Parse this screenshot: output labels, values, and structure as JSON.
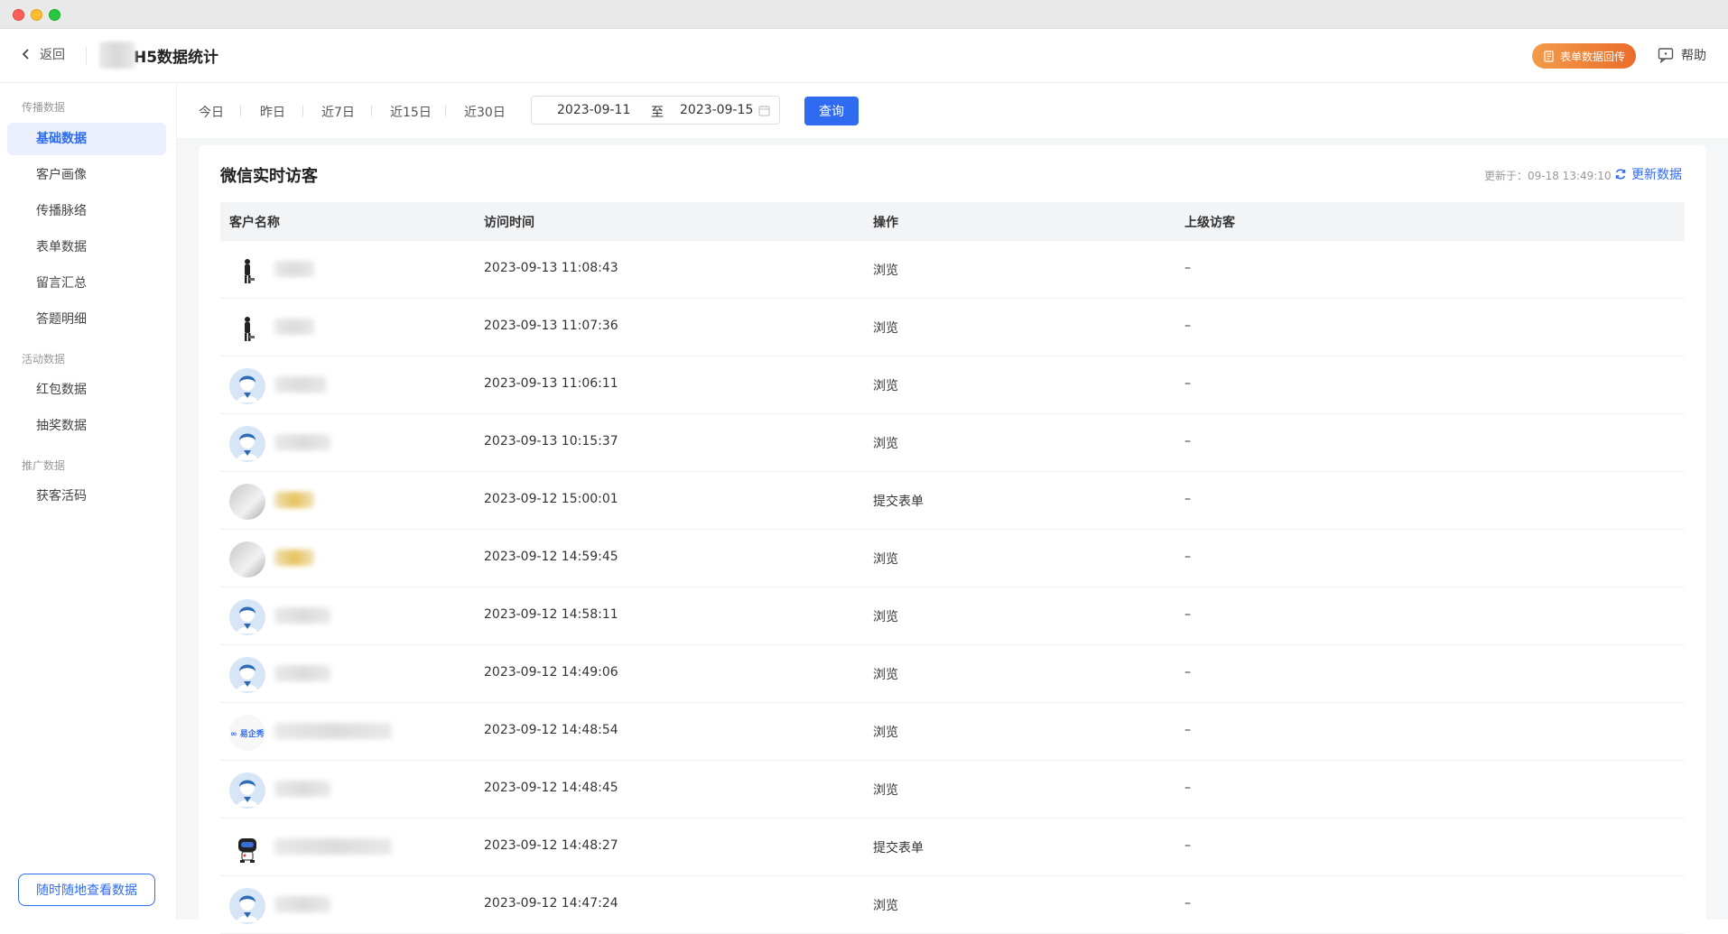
{
  "header": {
    "back_label": "返回",
    "title": "H5数据统计",
    "form_return_button": "表单数据回传",
    "help_label": "帮助"
  },
  "sidebar": {
    "groups": [
      {
        "label": "传播数据",
        "items": [
          "基础数据",
          "客户画像",
          "传播脉络",
          "表单数据",
          "留言汇总",
          "答题明细"
        ]
      },
      {
        "label": "活动数据",
        "items": [
          "红包数据",
          "抽奖数据"
        ]
      },
      {
        "label": "推广数据",
        "items": [
          "获客活码"
        ]
      }
    ],
    "active_item": "基础数据",
    "bottom_button": "随时随地查看数据"
  },
  "filters": {
    "quick": [
      "今日",
      "昨日",
      "近7日",
      "近15日",
      "近30日"
    ],
    "start_date": "2023-09-11",
    "to_label": "至",
    "end_date": "2023-09-15",
    "query_button": "查询"
  },
  "card": {
    "title": "微信实时访客",
    "updated_text": "更新于：09-18 13:49:10",
    "refresh_label": "更新数据"
  },
  "table": {
    "columns": [
      "客户名称",
      "访问时间",
      "操作",
      "上级访客"
    ],
    "rows": [
      {
        "avatar": "dark-figure-avatar",
        "time": "2023-09-13 11:08:43",
        "action": "浏览",
        "parent": "–"
      },
      {
        "avatar": "dark-figure-avatar",
        "time": "2023-09-13 11:07:36",
        "action": "浏览",
        "parent": "–"
      },
      {
        "avatar": "default-user-avatar",
        "time": "2023-09-13 11:06:11",
        "action": "浏览",
        "parent": "–"
      },
      {
        "avatar": "default-user-avatar",
        "time": "2023-09-13 10:15:37",
        "action": "浏览",
        "parent": "–"
      },
      {
        "avatar": "photo-avatar",
        "time": "2023-09-12 15:00:01",
        "action": "提交表单",
        "parent": "–"
      },
      {
        "avatar": "photo-avatar",
        "time": "2023-09-12 14:59:45",
        "action": "浏览",
        "parent": "–"
      },
      {
        "avatar": "default-user-avatar",
        "time": "2023-09-12 14:58:11",
        "action": "浏览",
        "parent": "–"
      },
      {
        "avatar": "default-user-avatar",
        "time": "2023-09-12 14:49:06",
        "action": "浏览",
        "parent": "–"
      },
      {
        "avatar": "logo-avatar",
        "time": "2023-09-12 14:48:54",
        "action": "浏览",
        "parent": "–"
      },
      {
        "avatar": "default-user-avatar",
        "time": "2023-09-12 14:48:45",
        "action": "浏览",
        "parent": "–"
      },
      {
        "avatar": "robot-avatar",
        "time": "2023-09-12 14:48:27",
        "action": "提交表单",
        "parent": "–"
      },
      {
        "avatar": "default-user-avatar",
        "time": "2023-09-12 14:47:24",
        "action": "浏览",
        "parent": "–"
      }
    ]
  },
  "colors": {
    "accent": "#2e6bf0",
    "orange_start": "#f39b4a",
    "orange_end": "#ea6d2a",
    "active_bg": "#eaf0fe"
  }
}
